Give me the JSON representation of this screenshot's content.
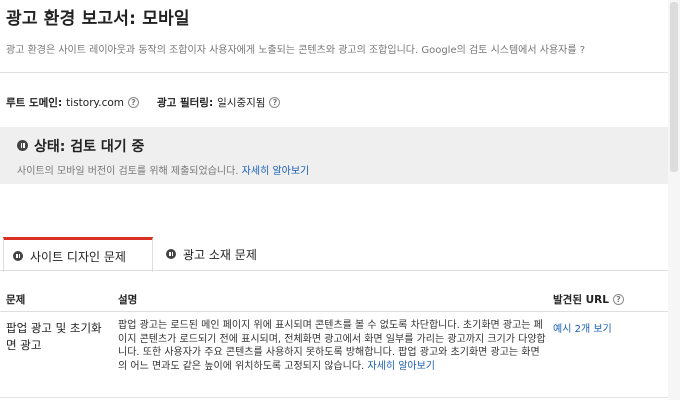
{
  "header": {
    "title": "광고 환경 보고서: 모바일",
    "description": "광고 환경은 사이트 레이아웃과 동작의 조합이자 사용자에게 노출되는 콘텐츠와 광고의 조합입니다. Google의 검토 시스템에서 사용자를 ?"
  },
  "meta": {
    "root_domain_label": "루트 도메인:",
    "root_domain_value": "tistory.com",
    "ad_filtering_label": "광고 필터링:",
    "ad_filtering_value": "일시중지됨",
    "help_glyph": "?"
  },
  "status": {
    "title": "상태: 검토 대기 중",
    "description": "사이트의 모바일 버전이 검토를 위해 제출되었습니다.",
    "learn_more": "자세히 알아보기"
  },
  "tabs": [
    {
      "label": "사이트 디자인 문제",
      "active": true
    },
    {
      "label": "광고 소재 문제",
      "active": false
    }
  ],
  "table": {
    "headers": {
      "problem": "문제",
      "description": "설명",
      "found_url": "발견된 URL"
    },
    "rows": [
      {
        "problem": "팝업 광고 및 초기화면 광고",
        "description": "팝업 광고는 로드된 메인 페이지 위에 표시되며 콘텐츠를 볼 수 없도록 차단합니다. 초기화면 광고는 페이지 콘텐츠가 로드되기 전에 표시되며, 전체화면 광고에서 화면 일부를 가리는 광고까지 크기가 다양합니다. 또한 사용자가 주요 콘텐츠를 사용하지 못하도록 방해합니다. 팝업 광고와 초기화면 광고는 화면의 어느 면과도 같은 높이에 위치하도록 고정되지 않습니다.",
        "learn_more": "자세히 알아보기",
        "url_link": "예시 2개 보기"
      }
    ]
  },
  "colors": {
    "accent_tab": "#d93025",
    "link": "#1a5fb4",
    "status_bg": "#efefef"
  }
}
